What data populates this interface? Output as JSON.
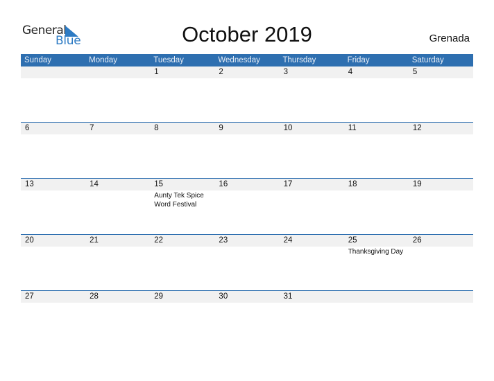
{
  "logo": {
    "word1": "General",
    "word2": "Blue"
  },
  "title": "October 2019",
  "country": "Grenada",
  "colors": {
    "accent": "#2e6fb0",
    "strip": "#f1f1f1",
    "logo_blue": "#2d7bc4"
  },
  "weekdays": [
    "Sunday",
    "Monday",
    "Tuesday",
    "Wednesday",
    "Thursday",
    "Friday",
    "Saturday"
  ],
  "weeks": [
    [
      "",
      "",
      "1",
      "2",
      "3",
      "4",
      "5"
    ],
    [
      "6",
      "7",
      "8",
      "9",
      "10",
      "11",
      "12"
    ],
    [
      "13",
      "14",
      "15",
      "16",
      "17",
      "18",
      "19"
    ],
    [
      "20",
      "21",
      "22",
      "23",
      "24",
      "25",
      "26"
    ],
    [
      "27",
      "28",
      "29",
      "30",
      "31",
      "",
      ""
    ]
  ],
  "events": [
    {
      "date": "15",
      "week": 2,
      "day": 2,
      "text": "Aunty Tek Spice Word Festival"
    },
    {
      "date": "25",
      "week": 3,
      "day": 5,
      "text": "Thanksgiving Day"
    }
  ]
}
